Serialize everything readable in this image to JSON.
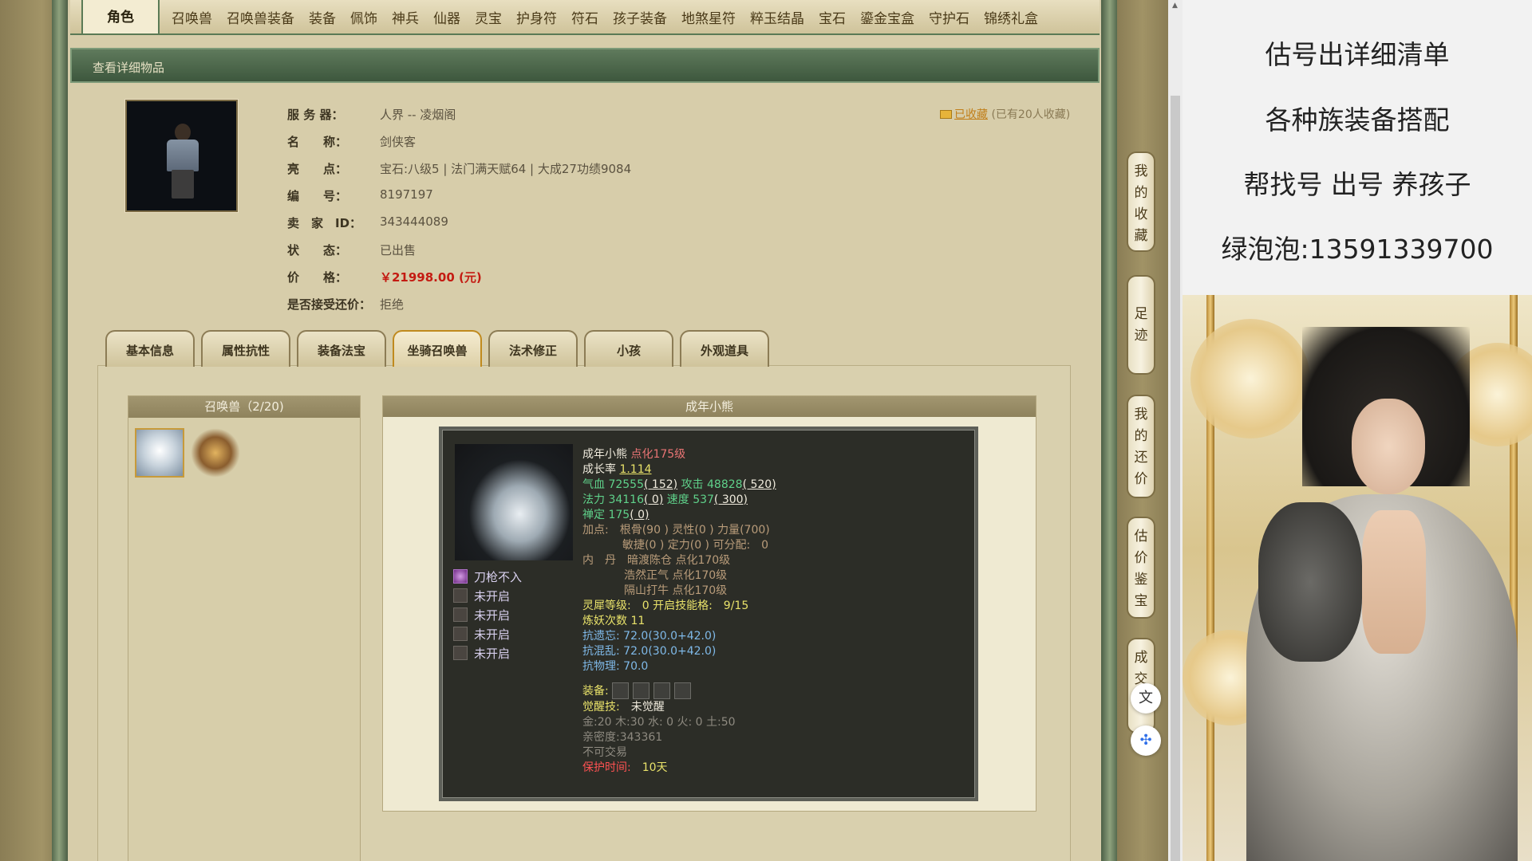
{
  "tabs": [
    "角色",
    "召唤兽",
    "召唤兽装备",
    "装备",
    "佩饰",
    "神兵",
    "仙器",
    "灵宝",
    "护身符",
    "符石",
    "孩子装备",
    "地煞星符",
    "粹玉结晶",
    "宝石",
    "鎏金宝盒",
    "守护石",
    "锦绣礼盒"
  ],
  "header": {
    "title": "查看详细物品"
  },
  "favorite": {
    "link": "已收藏",
    "count": "(已有20人收藏)"
  },
  "info": [
    {
      "key": "服 务 器：",
      "value": "人界 -- 凌烟阁"
    },
    {
      "key": "名　　称：",
      "value": "剑侠客"
    },
    {
      "key": "亮　　点：",
      "value": "宝石:八级5 | 法门满天赋64 | 大成27功绩9084"
    },
    {
      "key": "编　　号：",
      "value": "8197197"
    },
    {
      "key": "卖　家　ID：",
      "value": "343444089"
    },
    {
      "key": "状　　态：",
      "value": "已出售"
    },
    {
      "key": "价　　格：",
      "value": "￥21998.00 (元)"
    },
    {
      "key": "是否接受还价：",
      "value": "拒绝"
    }
  ],
  "inner_tabs": [
    "基本信息",
    "属性抗性",
    "装备法宝",
    "坐骑召唤兽",
    "法术修正",
    "小孩",
    "外观道具"
  ],
  "inner_tab_active": "坐骑召唤兽",
  "pets_panel": {
    "title": "召唤兽（2/20)"
  },
  "detail_panel": {
    "title": "成年小熊"
  },
  "pet": {
    "name": "成年小熊",
    "level": "点化175级",
    "growth_label": "成长率",
    "growth": "1.114",
    "hp_label": "气血",
    "hp": "72555",
    "hp_add": "( 152)",
    "atk_label": "攻击",
    "atk": "48828",
    "atk_add": "( 520)",
    "mp_label": "法力",
    "mp": "34116",
    "mp_add": "( 0)",
    "spd_label": "速度",
    "spd": "537",
    "spd_add": "( 300)",
    "zen_label": "禅定",
    "zen": "175",
    "zen_add": "( 0)",
    "points_1": "加点:　根骨(90 ) 灵性(0 ) 力量(700)",
    "points_2": "敏捷(0 ) 定力(0 ) 可分配:　0",
    "neidan_label": "内　丹",
    "neidan": [
      "暗渡陈仓 点化170级",
      "浩然正气 点化170级",
      "隔山打牛 点化170级"
    ],
    "lingxi": "灵犀等级:　0 开启技能格:　9/15",
    "lianyao": "炼妖次数 11",
    "res1": "抗遗忘: 72.0(30.0+42.0)",
    "res2": "抗混乱: 72.0(30.0+42.0)",
    "res3": "抗物理: 70.0",
    "equip_label": "装备:",
    "awaken_label": "觉醒技:",
    "awaken": "未觉醒",
    "elements": "金:20 木:30 水: 0 火: 0 土:50",
    "intimacy": "亲密度:343361",
    "trade": "不可交易",
    "protect_label": "保护时间:",
    "protect": "10天",
    "skills": [
      "刀枪不入",
      "未开启",
      "未开启",
      "未开启",
      "未开启"
    ]
  },
  "right_rail": [
    "我的收藏",
    "足迹",
    "我的还价",
    "估价鉴宝",
    "成交询"
  ],
  "ad": {
    "lines": [
      "估号出详细清单",
      "各种族装备搭配",
      "帮找号 出号 养孩子",
      "绿泡泡:13591339700"
    ]
  }
}
